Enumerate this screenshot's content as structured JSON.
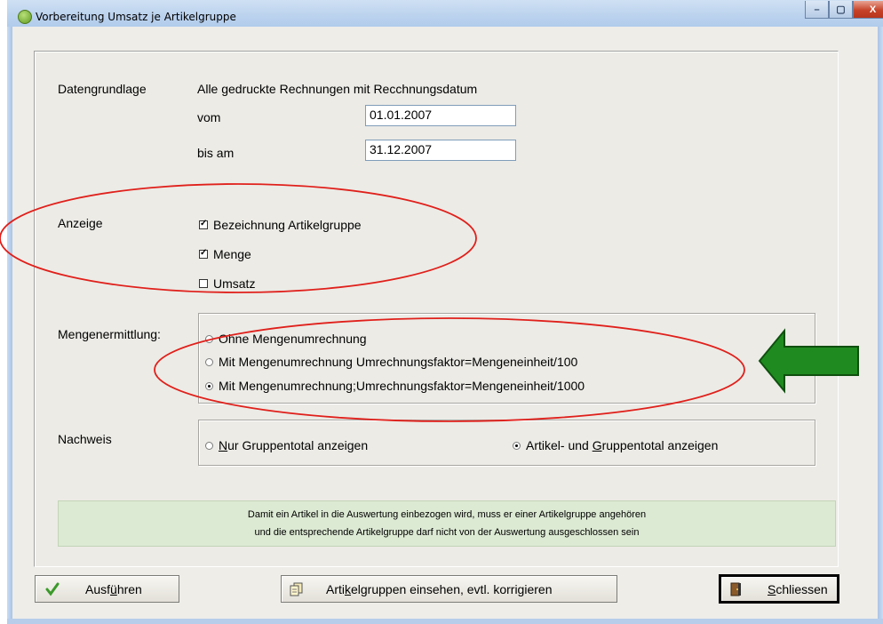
{
  "window": {
    "title": "Vorbereitung Umsatz je Artikelgruppe",
    "controls": [
      "–",
      "▢",
      "X"
    ]
  },
  "datengrundlage": {
    "label": "Datengrundlage",
    "description": "Alle gedruckte Rechnungen mit Recchnungsdatum",
    "from_label": "vom",
    "from_value": "01.01.2007",
    "to_label": "bis am",
    "to_value": "31.12.2007"
  },
  "anzeige": {
    "label": "Anzeige",
    "options": [
      {
        "label": "Bezeichnung Artikelgruppe",
        "checked": true
      },
      {
        "label": "Menge",
        "checked": true
      },
      {
        "label": "Umsatz",
        "checked": false
      }
    ]
  },
  "mengenermittlung": {
    "label": "Mengenermittlung:",
    "options": [
      {
        "label": "Ohne Mengenumrechnung",
        "selected": false
      },
      {
        "label": "Mit Mengenumrechnung Umrechnungsfaktor=Mengeneinheit/100",
        "selected": false
      },
      {
        "label": "Mit Mengenumrechnung;Umrechnungsfaktor=Mengeneinheit/1000",
        "selected": true
      }
    ]
  },
  "nachweis": {
    "label": "Nachweis",
    "options": [
      {
        "label_pre": "",
        "accel": "N",
        "label_post": "ur Gruppentotal anzeigen",
        "selected": false
      },
      {
        "label_pre": "Artikel- und ",
        "accel": "G",
        "label_post": "ruppentotal anzeigen",
        "selected": true
      }
    ]
  },
  "note": {
    "line1": "Damit ein Artikel in die Auswertung einbezogen wird, muss er einer Artikelgruppe angehören",
    "line2": "und die entsprechende Artikelgruppe darf nicht von der Auswertung ausgeschlossen sein"
  },
  "buttons": {
    "run": {
      "pre": "Ausf",
      "accel": "ü",
      "post": "hren"
    },
    "groups": {
      "pre": "Arti",
      "accel": "k",
      "post": "elgruppen einsehen, evtl. korrigieren"
    },
    "close": {
      "pre": "",
      "accel": "S",
      "post": "chliessen"
    }
  },
  "annotations": {
    "ellipse_color": "#e0201b",
    "arrow_color": "#1f8a1f"
  }
}
